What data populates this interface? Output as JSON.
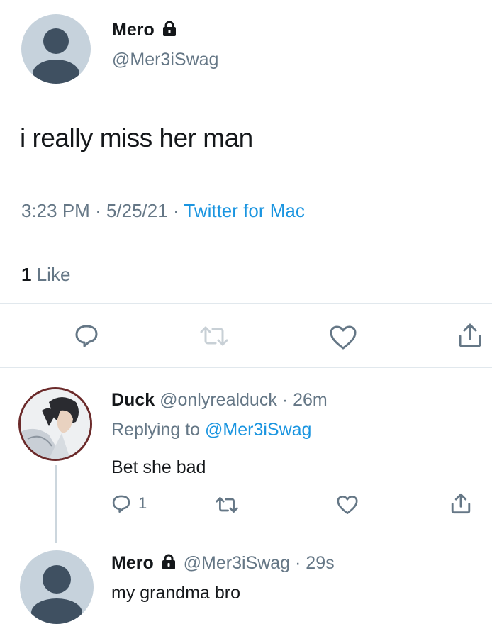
{
  "tweet": {
    "author_name": "Mero",
    "author_handle": "@Mer3iSwag",
    "text": "i really miss her man",
    "time": "3:23 PM",
    "date": "5/25/21",
    "source": "Twitter for Mac",
    "like_count": "1",
    "like_label": "Like",
    "icons": [
      "reply-icon",
      "retweet-icon",
      "like-icon",
      "share-icon"
    ]
  },
  "reply": {
    "author_name": "Duck",
    "author_handle": "@onlyrealduck",
    "age": "26m",
    "replying_prefix": "Replying to",
    "replying_handle": "@Mer3iSwag",
    "text": "Bet she bad",
    "reply_count": "1"
  },
  "reply2": {
    "author_name": "Mero",
    "author_handle": "@Mer3iSwag",
    "age": "29s",
    "text": "my grandma bro"
  },
  "colors": {
    "link": "#1b95e0",
    "secondary": "#657786",
    "divider": "#e1e8ed",
    "icon": "#657786"
  }
}
